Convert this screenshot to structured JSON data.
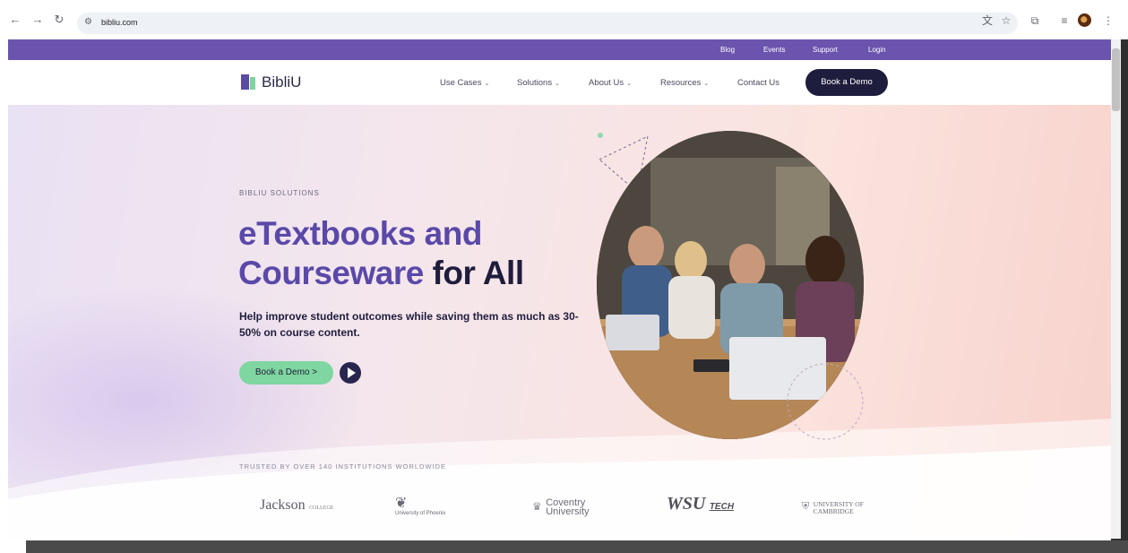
{
  "browser": {
    "url": "bibliu.com"
  },
  "topbar": {
    "links": [
      "Blog",
      "Events",
      "Support",
      "Login"
    ]
  },
  "header": {
    "logo_text": "BibliU",
    "menu": [
      {
        "label": "Use Cases",
        "dropdown": true
      },
      {
        "label": "Solutions",
        "dropdown": true
      },
      {
        "label": "About Us",
        "dropdown": true
      },
      {
        "label": "Resources",
        "dropdown": true
      },
      {
        "label": "Contact Us",
        "dropdown": false
      }
    ],
    "cta_label": "Book a Demo"
  },
  "hero": {
    "eyebrow": "BIBLIU SOLUTIONS",
    "headline_line1": "eTextbooks and",
    "headline_line2_colored": "Courseware",
    "headline_line2_dark": "for All",
    "subtext": "Help improve student outcomes while saving them as much as 30-50% on course content.",
    "cta_label": "Book a Demo >"
  },
  "trusted": {
    "label": "TRUSTED BY OVER 140 INSTITUTIONS WORLDWIDE",
    "logos": [
      {
        "main": "Jackson",
        "sub": "COLLEGE"
      },
      {
        "main": "University of Phoenix"
      },
      {
        "main": "Coventry",
        "sub": "University"
      },
      {
        "main": "WSU",
        "sub": "TECH"
      },
      {
        "main": "UNIVERSITY OF",
        "sub": "CAMBRIDGE"
      }
    ]
  },
  "colors": {
    "brand_purple": "#6a54ad",
    "headline_purple": "#5a49a8",
    "dark_navy": "#1f1d3d",
    "mint": "#7fd6a0"
  }
}
